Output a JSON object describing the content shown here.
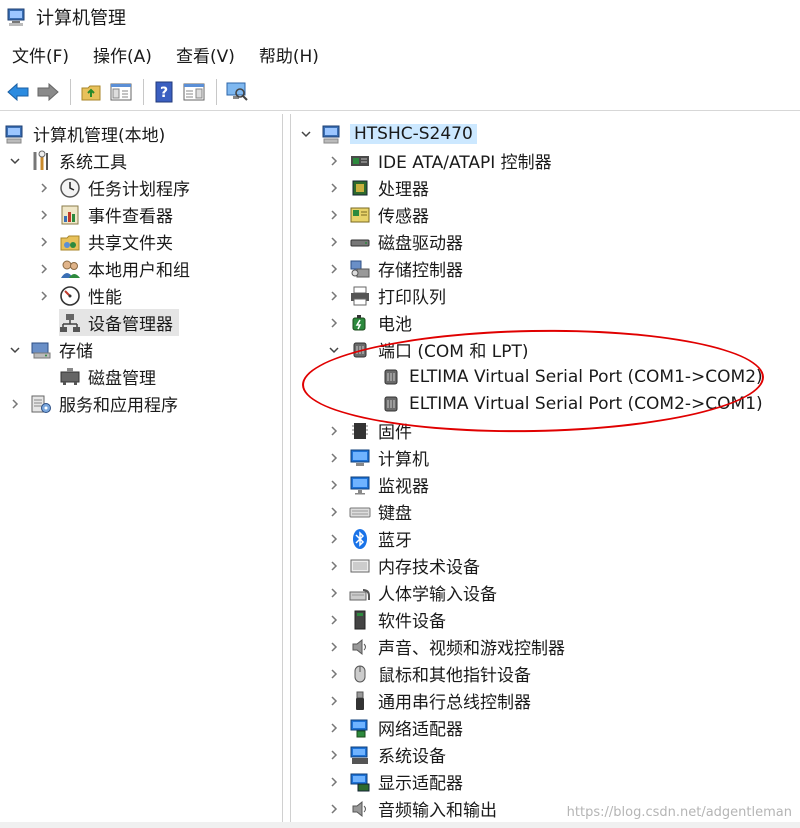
{
  "window": {
    "title": "计算机管理"
  },
  "menu": [
    "文件(F)",
    "操作(A)",
    "查看(V)",
    "帮助(H)"
  ],
  "left_tree": {
    "root": "计算机管理(本地)",
    "system_tools": "系统工具",
    "system_children": [
      "任务计划程序",
      "事件查看器",
      "共享文件夹",
      "本地用户和组",
      "性能",
      "设备管理器"
    ],
    "storage": "存储",
    "storage_children": [
      "磁盘管理"
    ],
    "services": "服务和应用程序"
  },
  "right_tree": {
    "root": "HTSHC-S2470",
    "categories_top": [
      "IDE ATA/ATAPI 控制器",
      "处理器",
      "传感器",
      "磁盘驱动器",
      "存储控制器",
      "打印队列",
      "电池"
    ],
    "ports": "端口 (COM 和 LPT)",
    "port_children": [
      "ELTIMA Virtual Serial Port (COM1->COM2)",
      "ELTIMA Virtual Serial Port (COM2->COM1)"
    ],
    "categories_bottom": [
      "固件",
      "计算机",
      "监视器",
      "键盘",
      "蓝牙",
      "内存技术设备",
      "人体学输入设备",
      "软件设备",
      "声音、视频和游戏控制器",
      "鼠标和其他指针设备",
      "通用串行总线控制器",
      "网络适配器",
      "系统设备",
      "显示适配器",
      "音频输入和输出"
    ]
  },
  "watermark": "https://blog.csdn.net/adgentleman",
  "colors": {
    "annotation": "#e00000",
    "selection": "#cce8ff",
    "bluetooth": "#1a73e8"
  }
}
